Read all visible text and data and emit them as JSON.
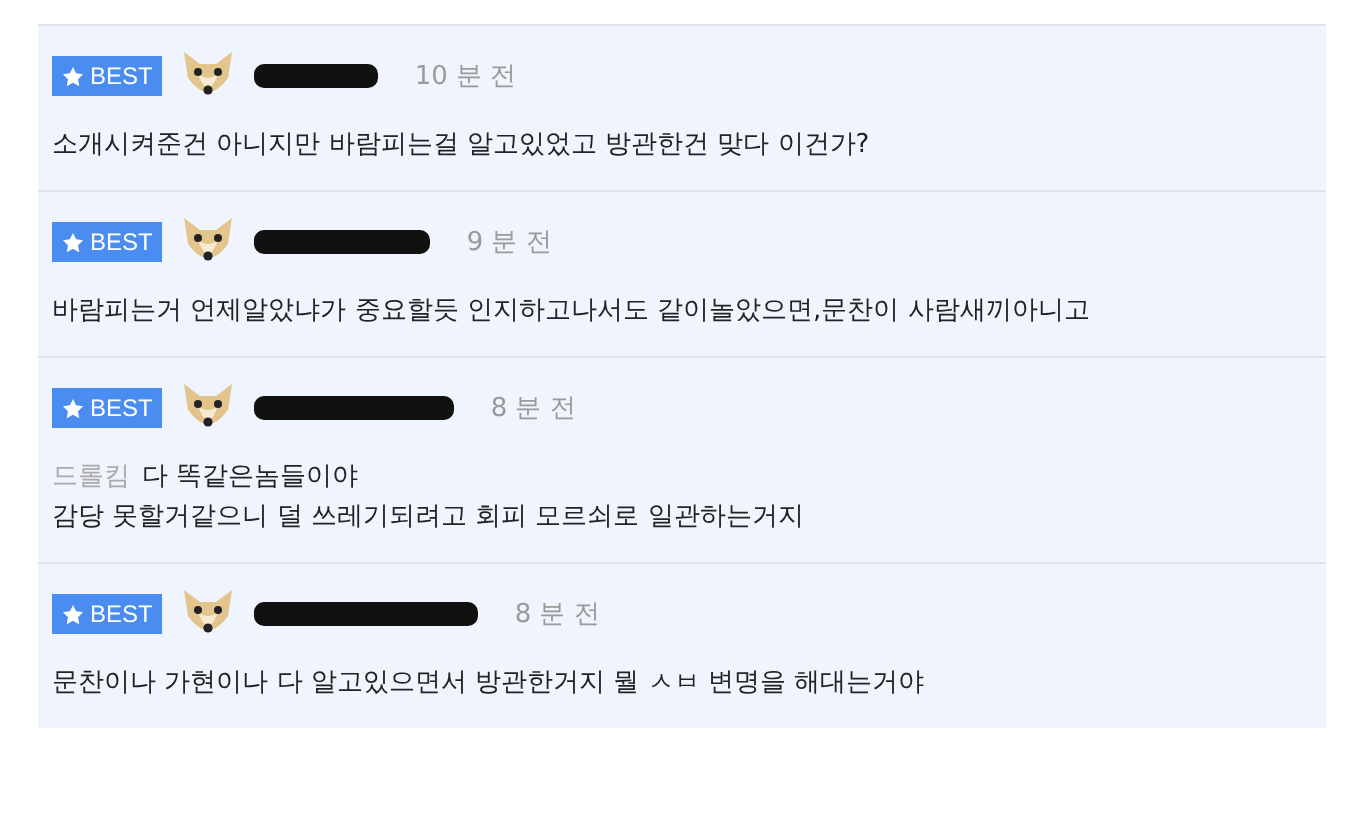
{
  "comments": [
    {
      "badge": "BEST",
      "time": "10 분 전",
      "lines": [
        "소개시켜준건 아니지만 바람피는걸 알고있었고 방관한건 맞다 이건가?"
      ]
    },
    {
      "badge": "BEST",
      "time": "9 분 전",
      "lines": [
        "바람피는거 언제알았냐가 중요할듯 인지하고나서도 같이놀았으면,문찬이 사람새끼아니고"
      ]
    },
    {
      "badge": "BEST",
      "time": "8 분 전",
      "mention": "드롤킴",
      "lines": [
        "다 똑같은놈들이야",
        "감당 못할거같으니 덜 쓰레기되려고 회피 모르쇠로 일관하는거지"
      ]
    },
    {
      "badge": "BEST",
      "time": "8 분 전",
      "lines": [
        "문찬이나 가현이나 다 알고있으면서 방관한거지 뭘 ㅅㅂ 변명을 해대는거야"
      ]
    }
  ]
}
